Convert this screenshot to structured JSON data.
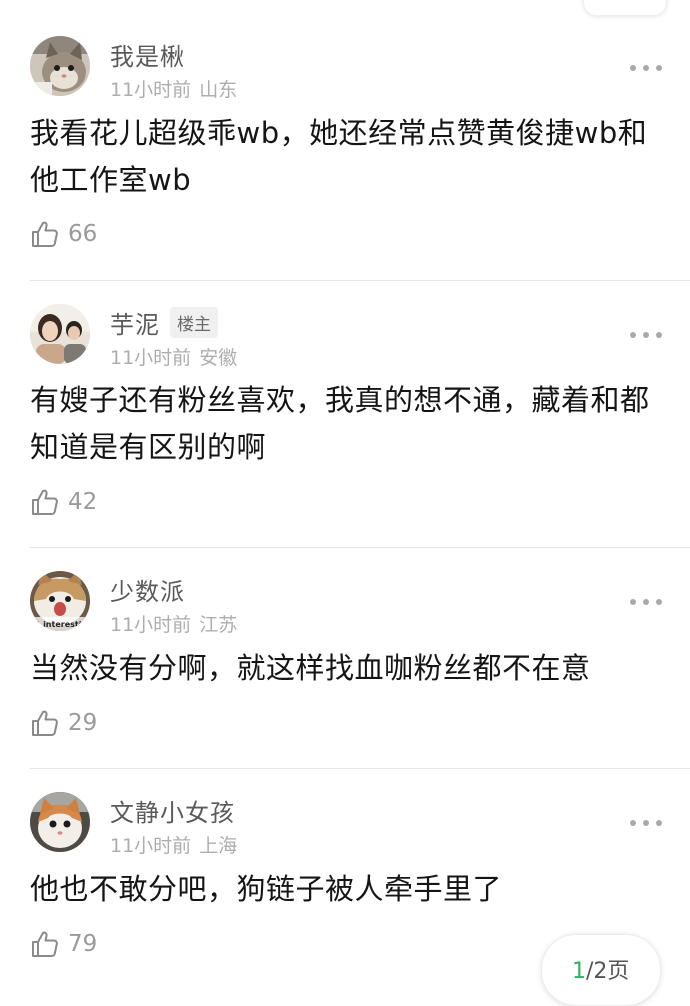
{
  "comments": [
    {
      "name": "我是楸",
      "badge": "",
      "time": "11小时前",
      "location": "山东",
      "content": "我看花儿超级乖wb，她还经常点赞黄俊捷wb和他工作室wb",
      "likes": "66",
      "avatar_icon": "cat-avatar"
    },
    {
      "name": "芋泥",
      "badge": "楼主",
      "time": "11小时前",
      "location": "安徽",
      "content": "有嫂子还有粉丝喜欢，我真的想不通，藏着和都知道是有区别的啊",
      "likes": "42",
      "avatar_icon": "photo-avatar"
    },
    {
      "name": "少数派",
      "badge": "",
      "time": "11小时前",
      "location": "江苏",
      "content": "当然没有分啊，就这样找血咖粉丝都不在意",
      "likes": "29",
      "avatar_icon": "cat-avatar",
      "avatar_caption": "T. interesti"
    },
    {
      "name": "文静小女孩",
      "badge": "",
      "time": "11小时前",
      "location": "上海",
      "content": "他也不敢分吧，狗链子被人牵手里了",
      "likes": "79",
      "avatar_icon": "cat-avatar"
    }
  ],
  "pager": {
    "current": "1",
    "rest": "/2页"
  },
  "colors": {
    "name": "#5a5a5a",
    "meta": "#adadad",
    "content": "#151515",
    "pager_current": "#2fb25a"
  }
}
